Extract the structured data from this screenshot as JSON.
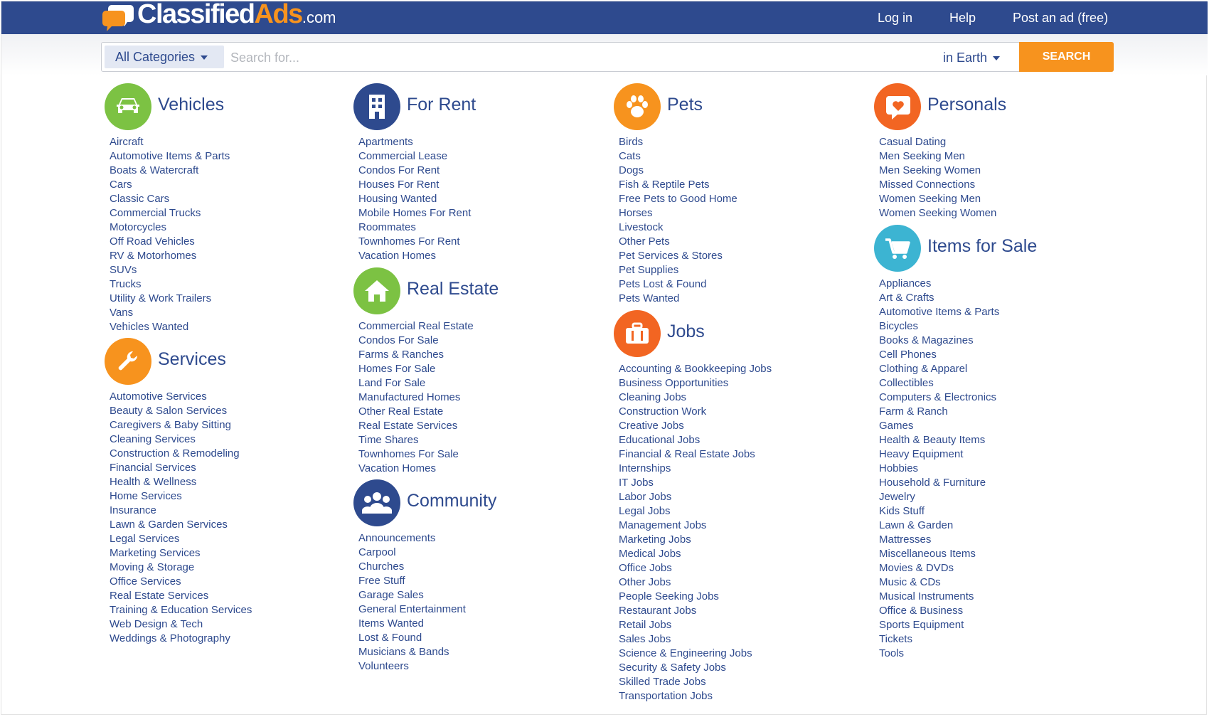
{
  "header": {
    "logo": {
      "part1": "Classified",
      "part2": "Ads",
      "part3": ".com"
    },
    "nav": {
      "login": "Log in",
      "help": "Help",
      "post": "Post an ad (free)"
    }
  },
  "search": {
    "category_label": "All Categories",
    "placeholder": "Search for...",
    "location_label": "in Earth",
    "button_label": "SEARCH"
  },
  "colors": {
    "header_bg": "#2e4a8e",
    "accent_orange": "#f7931e",
    "link": "#2e4a8e"
  },
  "categories": {
    "vehicles": {
      "title": "Vehicles",
      "icon": "car-icon",
      "icon_color": "#7cc243",
      "items": [
        "Aircraft",
        "Automotive Items & Parts",
        "Boats & Watercraft",
        "Cars",
        "Classic Cars",
        "Commercial Trucks",
        "Motorcycles",
        "Off Road Vehicles",
        "RV & Motorhomes",
        "SUVs",
        "Trucks",
        "Utility & Work Trailers",
        "Vans",
        "Vehicles Wanted"
      ]
    },
    "services": {
      "title": "Services",
      "icon": "wrench-icon",
      "icon_color": "#f7931e",
      "items": [
        "Automotive Services",
        "Beauty & Salon Services",
        "Caregivers & Baby Sitting",
        "Cleaning Services",
        "Construction & Remodeling",
        "Financial Services",
        "Health & Wellness",
        "Home Services",
        "Insurance",
        "Lawn & Garden Services",
        "Legal Services",
        "Marketing Services",
        "Moving & Storage",
        "Office Services",
        "Real Estate Services",
        "Training & Education Services",
        "Web Design & Tech",
        "Weddings & Photography"
      ]
    },
    "for_rent": {
      "title": "For Rent",
      "icon": "building-icon",
      "icon_color": "#2e4a8e",
      "items": [
        "Apartments",
        "Commercial Lease",
        "Condos For Rent",
        "Houses For Rent",
        "Housing Wanted",
        "Mobile Homes For Rent",
        "Roommates",
        "Townhomes For Rent",
        "Vacation Homes"
      ]
    },
    "real_estate": {
      "title": "Real Estate",
      "icon": "house-icon",
      "icon_color": "#7cc243",
      "items": [
        "Commercial Real Estate",
        "Condos For Sale",
        "Farms & Ranches",
        "Homes For Sale",
        "Land For Sale",
        "Manufactured Homes",
        "Other Real Estate",
        "Real Estate Services",
        "Time Shares",
        "Townhomes For Sale",
        "Vacation Homes"
      ]
    },
    "community": {
      "title": "Community",
      "icon": "people-icon",
      "icon_color": "#2e4a8e",
      "items": [
        "Announcements",
        "Carpool",
        "Churches",
        "Free Stuff",
        "Garage Sales",
        "General Entertainment",
        "Items Wanted",
        "Lost & Found",
        "Musicians & Bands",
        "Volunteers"
      ]
    },
    "pets": {
      "title": "Pets",
      "icon": "paw-icon",
      "icon_color": "#f7931e",
      "items": [
        "Birds",
        "Cats",
        "Dogs",
        "Fish & Reptile Pets",
        "Free Pets to Good Home",
        "Horses",
        "Livestock",
        "Other Pets",
        "Pet Services & Stores",
        "Pet Supplies",
        "Pets Lost & Found",
        "Pets Wanted"
      ]
    },
    "jobs": {
      "title": "Jobs",
      "icon": "briefcase-icon",
      "icon_color": "#f26522",
      "items": [
        "Accounting & Bookkeeping Jobs",
        "Business Opportunities",
        "Cleaning Jobs",
        "Construction Work",
        "Creative Jobs",
        "Educational Jobs",
        "Financial & Real Estate Jobs",
        "Internships",
        "IT Jobs",
        "Labor Jobs",
        "Legal Jobs",
        "Management Jobs",
        "Marketing Jobs",
        "Medical Jobs",
        "Office Jobs",
        "Other Jobs",
        "People Seeking Jobs",
        "Restaurant Jobs",
        "Retail Jobs",
        "Sales Jobs",
        "Science & Engineering Jobs",
        "Security & Safety Jobs",
        "Skilled Trade Jobs",
        "Transportation Jobs"
      ]
    },
    "personals": {
      "title": "Personals",
      "icon": "chat-heart-icon",
      "icon_color": "#f26522",
      "items": [
        "Casual Dating",
        "Men Seeking Men",
        "Men Seeking Women",
        "Missed Connections",
        "Women Seeking Men",
        "Women Seeking Women"
      ]
    },
    "items_for_sale": {
      "title": "Items for Sale",
      "icon": "cart-icon",
      "icon_color": "#3cb4d2",
      "items": [
        "Appliances",
        "Art & Crafts",
        "Automotive Items & Parts",
        "Bicycles",
        "Books & Magazines",
        "Cell Phones",
        "Clothing & Apparel",
        "Collectibles",
        "Computers & Electronics",
        "Farm & Ranch",
        "Games",
        "Health & Beauty Items",
        "Heavy Equipment",
        "Hobbies",
        "Household & Furniture",
        "Jewelry",
        "Kids Stuff",
        "Lawn & Garden",
        "Mattresses",
        "Miscellaneous Items",
        "Movies & DVDs",
        "Music & CDs",
        "Musical Instruments",
        "Office & Business",
        "Sports Equipment",
        "Tickets",
        "Tools"
      ]
    }
  }
}
